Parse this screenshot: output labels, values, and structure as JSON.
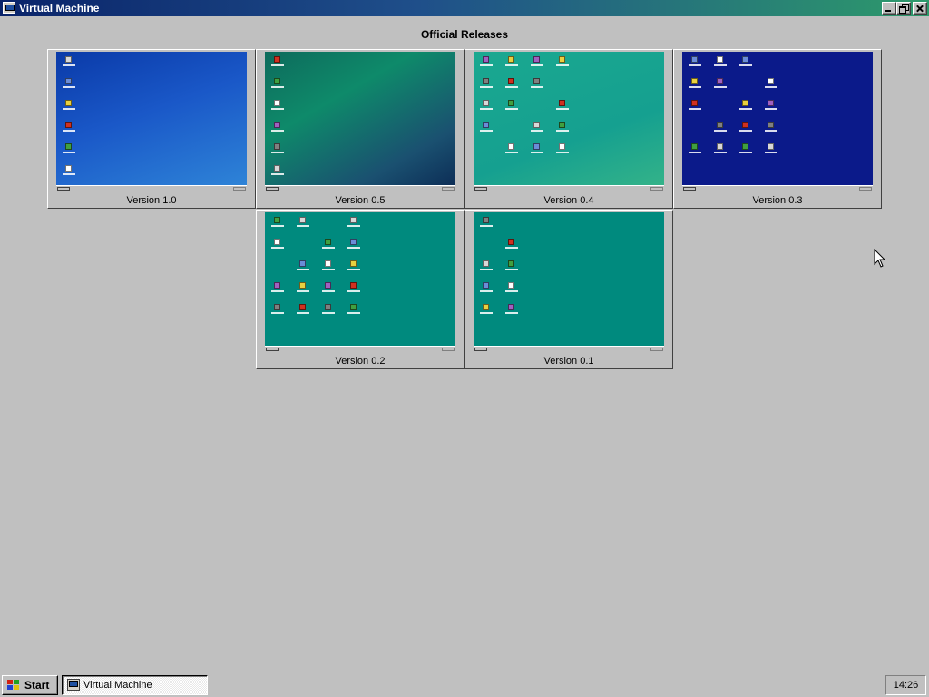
{
  "window": {
    "title": "Virtual Machine",
    "title_gradient": [
      "#0a246a",
      "#2d9a6b"
    ]
  },
  "main": {
    "heading": "Official Releases",
    "releases": [
      {
        "label": "Version 1.0",
        "desktop": "blue"
      },
      {
        "label": "Version 0.5",
        "desktop": "green"
      },
      {
        "label": "Version 0.4",
        "desktop": "teal"
      },
      {
        "label": "Version 0.3",
        "desktop": "navy"
      },
      {
        "label": "Version 0.2",
        "desktop": "flat-teal"
      },
      {
        "label": "Version 0.1",
        "desktop": "flat-teal"
      }
    ]
  },
  "taskbar": {
    "start_label": "Start",
    "task_label": "Virtual Machine",
    "clock": "14:26"
  },
  "icons": {
    "app": "virtual-machine-icon",
    "start": "windows-logo-icon",
    "cursor": "mouse-pointer-icon"
  }
}
